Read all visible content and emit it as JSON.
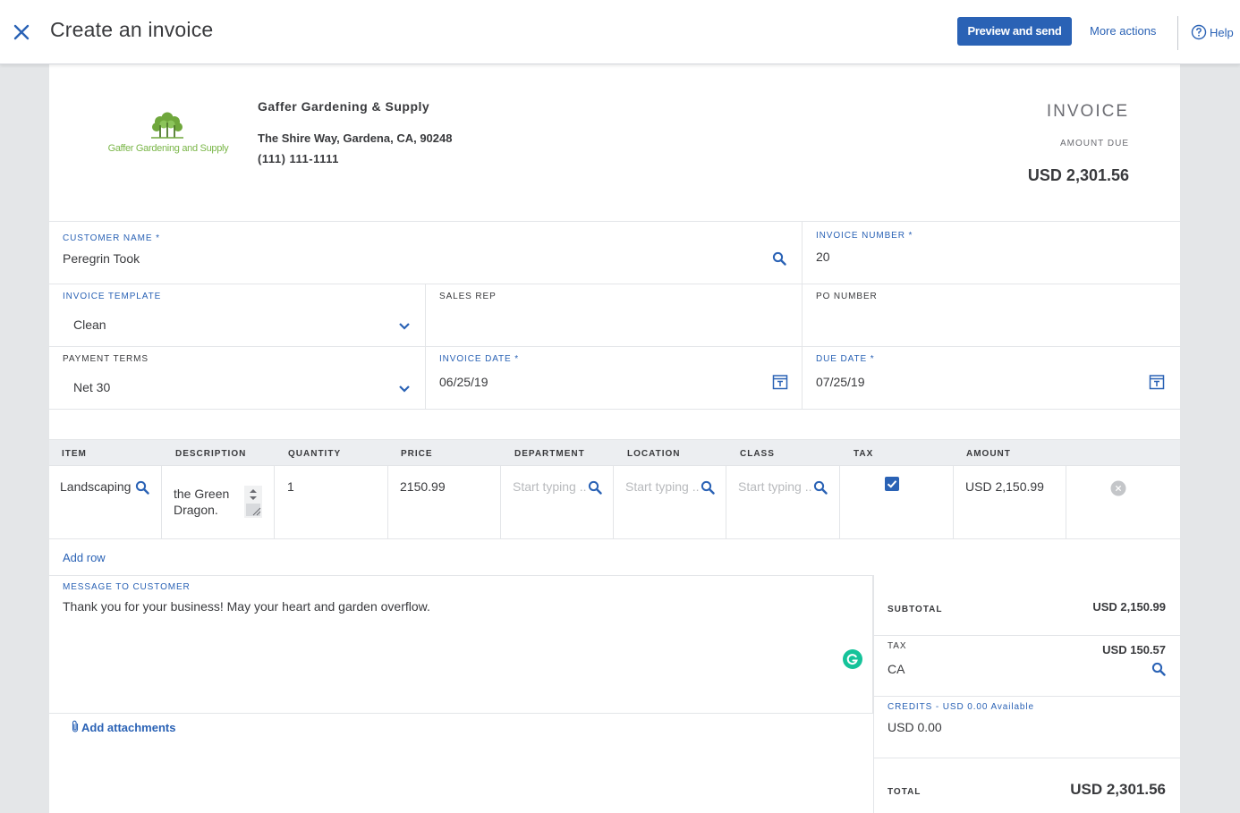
{
  "header": {
    "title": "Create an invoice",
    "preview_label": "Preview and send",
    "more_actions_label": "More actions",
    "help_label": "Help"
  },
  "company": {
    "logo_text": "Gaffer Gardening and Supply",
    "name": "Gaffer Gardening & Supply",
    "address": "The Shire Way, Gardena, CA, 90248",
    "phone": "(111) 111-1111"
  },
  "invoice_summary": {
    "label": "INVOICE",
    "amount_due_label": "AMOUNT DUE",
    "amount_due": "USD 2,301.56"
  },
  "form": {
    "customer_name_label": "CUSTOMER NAME *",
    "customer_name": "Peregrin Took",
    "invoice_number_label": "INVOICE NUMBER *",
    "invoice_number": "20",
    "invoice_template_label": "INVOICE TEMPLATE",
    "invoice_template": "Clean",
    "sales_rep_label": "SALES REP",
    "sales_rep": "",
    "po_number_label": "PO NUMBER",
    "po_number": "",
    "payment_terms_label": "PAYMENT TERMS",
    "payment_terms": "Net 30",
    "invoice_date_label": "INVOICE DATE *",
    "invoice_date": "06/25/19",
    "due_date_label": "DUE DATE *",
    "due_date": "07/25/19"
  },
  "line_table": {
    "headers": [
      "ITEM",
      "DESCRIPTION",
      "QUANTITY",
      "PRICE",
      "DEPARTMENT",
      "LOCATION",
      "CLASS",
      "TAX",
      "AMOUNT"
    ],
    "row": {
      "item": "Landscaping",
      "description_line1": "the Green",
      "description_line2": "Dragon.",
      "quantity": "1",
      "price": "2150.99",
      "department_placeholder": "Start typing ...",
      "location_placeholder": "Start typing ...",
      "class_placeholder": "Start typing ...",
      "tax_checked": true,
      "amount": "USD 2,150.99"
    },
    "add_row_label": "Add row"
  },
  "message": {
    "label": "MESSAGE TO CUSTOMER",
    "text": "Thank you for your business! May your heart and garden overflow."
  },
  "attachments_label": "Add attachments",
  "totals": {
    "subtotal_label": "SUBTOTAL",
    "subtotal": "USD 2,150.99",
    "tax_label": "TAX",
    "tax_amount": "USD 150.57",
    "tax_rate": "CA",
    "credits_label": "CREDITS - USD 0.00 Available",
    "credits": "USD 0.00",
    "total_label": "TOTAL",
    "total": "USD 2,301.56"
  },
  "colors": {
    "accent": "#2a62b5",
    "logo_green": "#7ab648",
    "grammarly": "#15c39a"
  }
}
